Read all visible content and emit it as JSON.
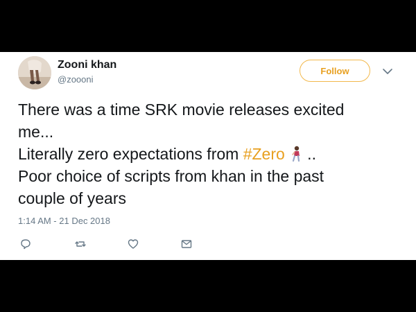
{
  "tweet": {
    "author": {
      "name": "Zooni khan",
      "handle": "@zoooni"
    },
    "follow_label": "Follow",
    "text": {
      "line1": "There was a time SRK movie releases excited",
      "line2": "me...",
      "line3_prefix": "Literally zero expectations from ",
      "hashtag": "#Zero",
      "line3_suffix": " ..",
      "line4": "Poor choice of scripts from khan in the past",
      "line5": "couple of years"
    },
    "timestamp": "1:14 AM - 21 Dec 2018"
  },
  "icons": {
    "reply": "reply-icon",
    "retweet": "retweet-icon",
    "like": "heart-icon",
    "message": "envelope-icon",
    "caret": "chevron-down-icon",
    "emoji": "person-emoji-icon"
  },
  "colors": {
    "accent": "#e8a020",
    "text": "#14171a",
    "muted": "#657786",
    "background": "#000000",
    "card": "#ffffff"
  }
}
